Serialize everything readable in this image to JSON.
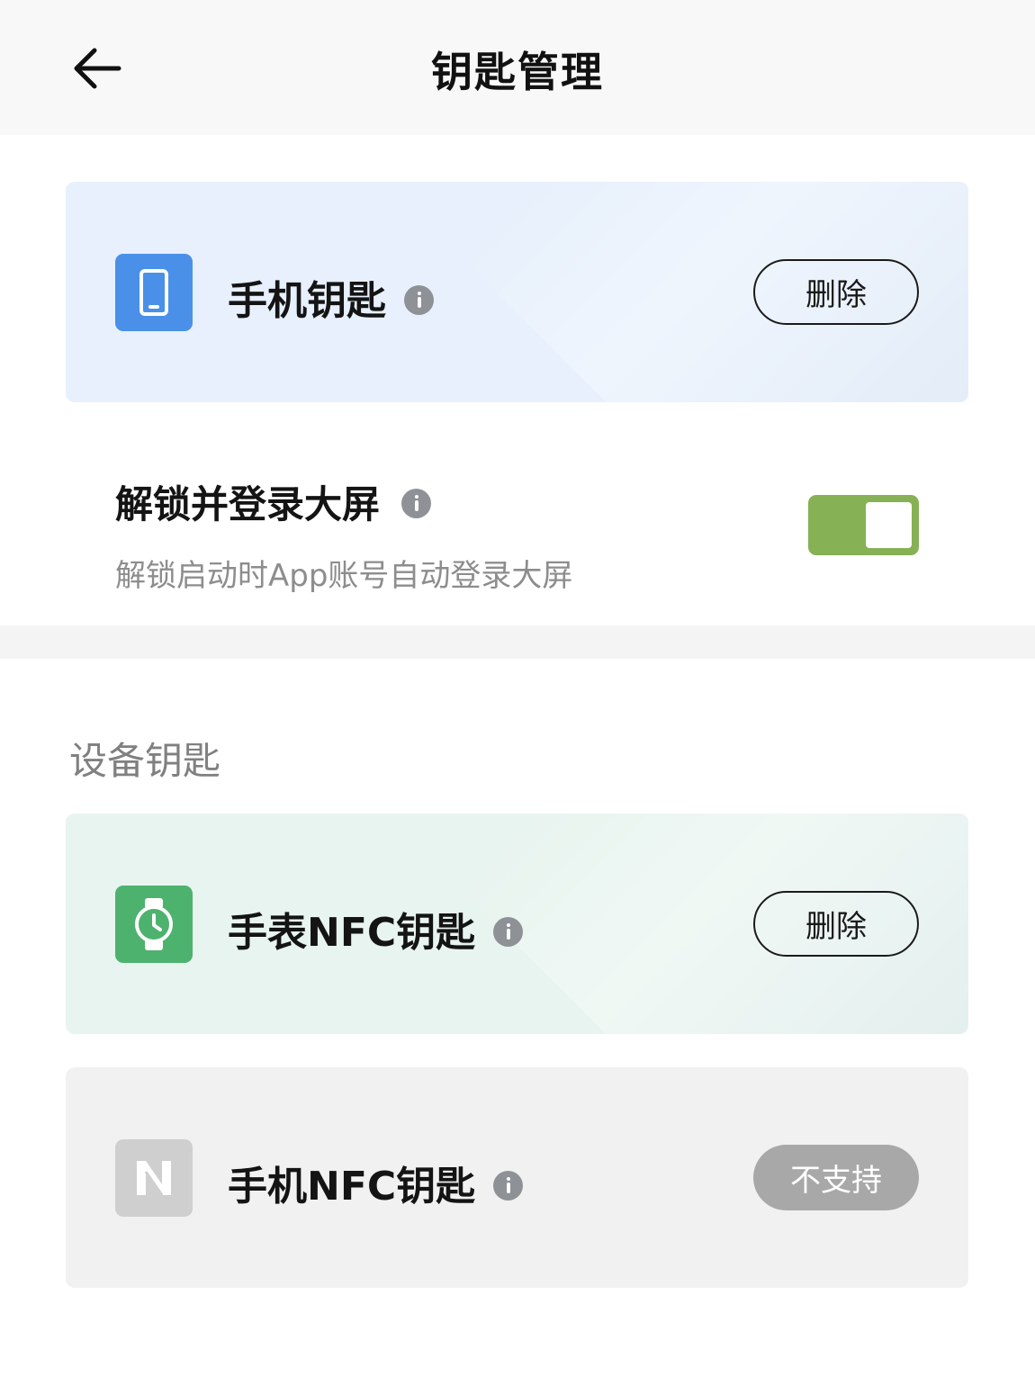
{
  "header": {
    "title": "钥匙管理",
    "back_icon": "arrow-left-icon"
  },
  "phone_key": {
    "label": "手机钥匙",
    "icon": "smartphone-icon",
    "icon_color": "#4a90e8",
    "action_label": "删除"
  },
  "unlock_setting": {
    "title": "解锁并登录大屏",
    "description": "解锁启动时App账号自动登录大屏",
    "enabled": true,
    "toggle_color": "#86b154"
  },
  "device_keys": {
    "section_title": "设备钥匙",
    "items": [
      {
        "label": "手表NFC钥匙",
        "icon": "smartwatch-icon",
        "icon_color": "#4db26d",
        "action_label": "删除",
        "supported": true
      },
      {
        "label": "手机NFC钥匙",
        "icon": "nfc-icon",
        "icon_color": "#cfcfcf",
        "action_label": "不支持",
        "supported": false
      }
    ]
  }
}
